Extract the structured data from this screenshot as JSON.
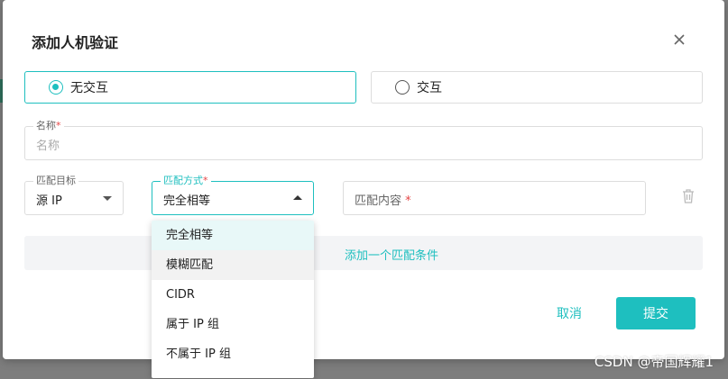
{
  "dialog": {
    "title": "添加人机验证",
    "close_icon": "close-icon"
  },
  "radio_options": [
    {
      "label": "无交互",
      "selected": true
    },
    {
      "label": "交互",
      "selected": false
    }
  ],
  "name_field": {
    "label": "名称",
    "required_mark": "*",
    "placeholder": "名称"
  },
  "match_target": {
    "label": "匹配目标",
    "value": "源 IP"
  },
  "match_method": {
    "label": "匹配方式",
    "required_mark": "*",
    "value": "完全相等",
    "options": [
      "完全相等",
      "模糊匹配",
      "CIDR",
      "属于 IP 组",
      "不属于 IP 组"
    ]
  },
  "match_content": {
    "placeholder": "匹配内容",
    "required_mark": "*"
  },
  "add_condition": {
    "label": "添加一个匹配条件"
  },
  "buttons": {
    "cancel": "取消",
    "submit": "提交"
  },
  "watermark": "CSDN @帝国辉耀1",
  "colors": {
    "accent": "#1ebfbf",
    "required": "#e54545",
    "overlay": "#7d7d7d"
  }
}
